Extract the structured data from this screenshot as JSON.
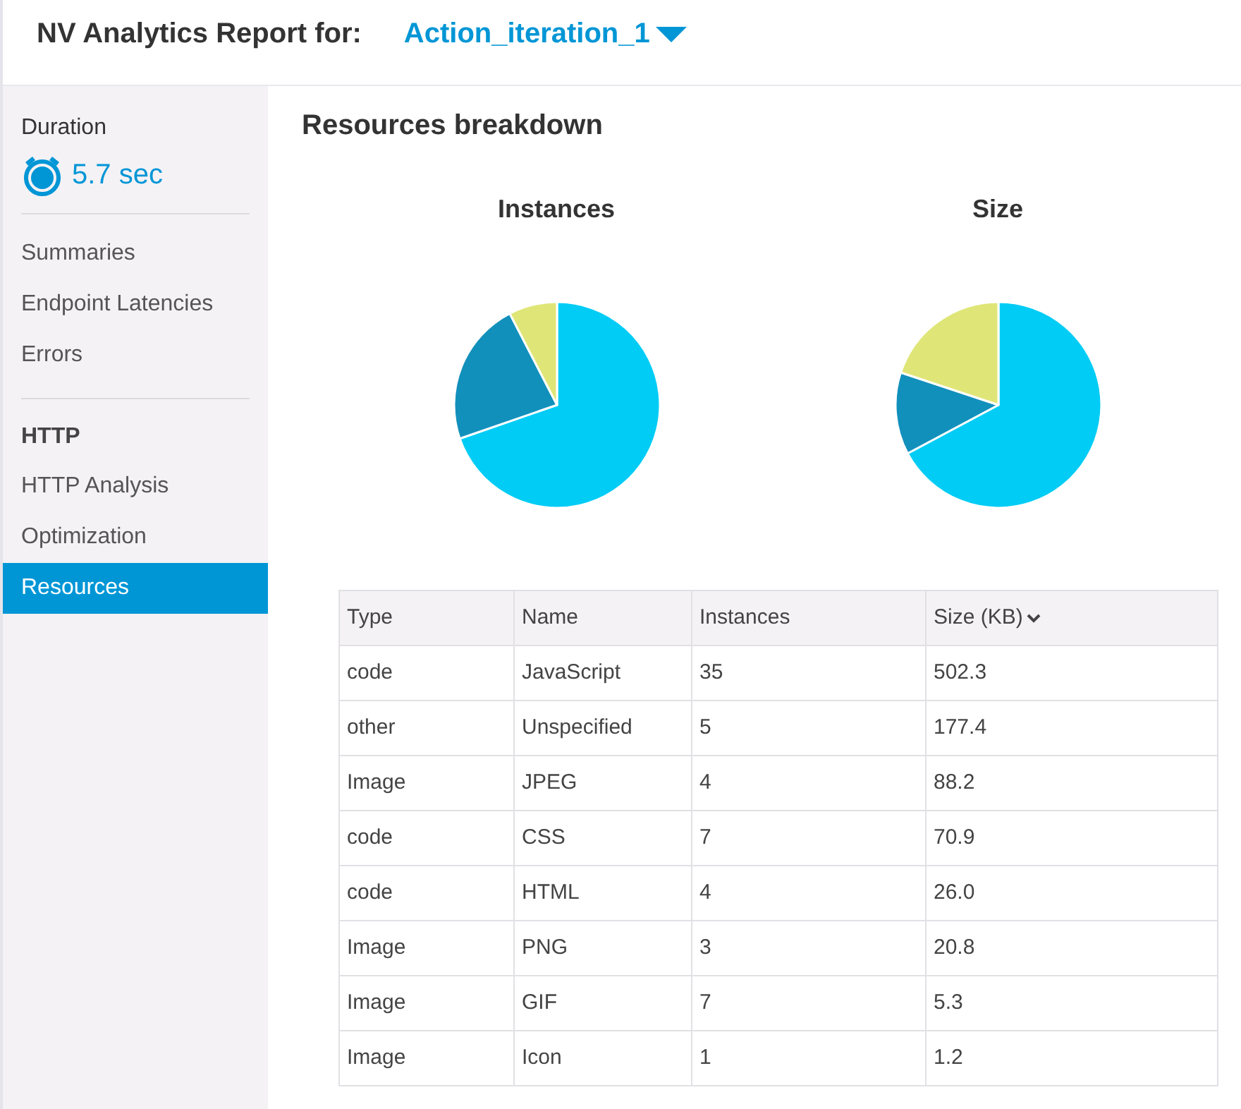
{
  "header": {
    "title": "NV Analytics Report for:",
    "selection": "Action_iteration_1"
  },
  "sidebar": {
    "duration": {
      "label": "Duration",
      "value": "5.7 sec"
    },
    "groups": [
      {
        "items": [
          {
            "label": "Summaries",
            "selected": false
          },
          {
            "label": "Endpoint Latencies",
            "selected": false
          },
          {
            "label": "Errors",
            "selected": false
          }
        ]
      },
      {
        "heading": "HTTP",
        "items": [
          {
            "label": "HTTP Analysis",
            "selected": false
          },
          {
            "label": "Optimization",
            "selected": false
          },
          {
            "label": "Resources",
            "selected": true
          }
        ]
      }
    ]
  },
  "main": {
    "title": "Resources breakdown",
    "charts": [
      {
        "title": "Instances"
      },
      {
        "title": "Size"
      }
    ],
    "table": {
      "columns": [
        {
          "label": "Type",
          "sorted": false
        },
        {
          "label": "Name",
          "sorted": false
        },
        {
          "label": "Instances",
          "sorted": false
        },
        {
          "label": "Size (KB)",
          "sorted": true
        }
      ],
      "rows": [
        [
          "code",
          "JavaScript",
          "35",
          "502.3"
        ],
        [
          "other",
          "Unspecified",
          "5",
          "177.4"
        ],
        [
          "Image",
          "JPEG",
          "4",
          "88.2"
        ],
        [
          "code",
          "CSS",
          "7",
          "70.9"
        ],
        [
          "code",
          "HTML",
          "4",
          "26.0"
        ],
        [
          "Image",
          "PNG",
          "3",
          "20.8"
        ],
        [
          "Image",
          "GIF",
          "7",
          "5.3"
        ],
        [
          "Image",
          "Icon",
          "1",
          "1.2"
        ]
      ]
    }
  }
}
